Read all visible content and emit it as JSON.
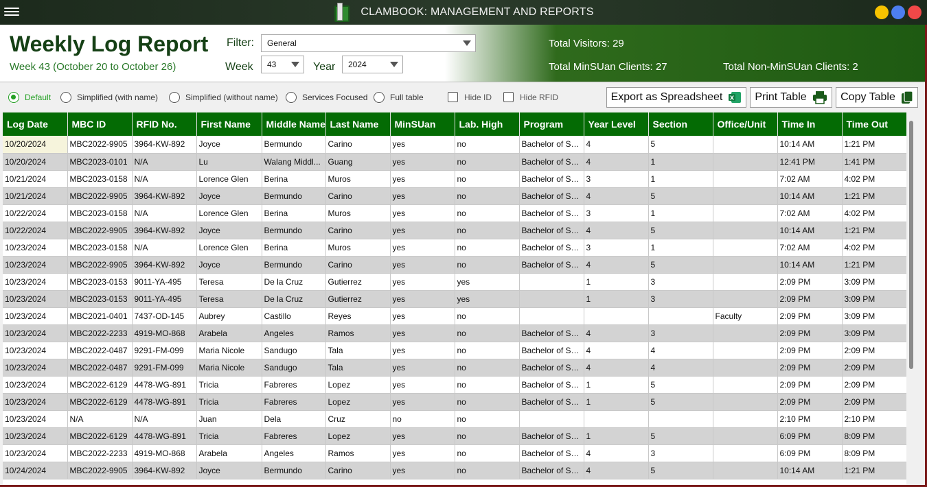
{
  "app": {
    "title": "CLAMBOOK: MANAGEMENT AND REPORTS"
  },
  "colors": {
    "yellow": "#f7c300",
    "blue": "#4d7ef0",
    "red": "#f04848",
    "accent": "#046b04"
  },
  "header": {
    "title": "Weekly Log Report",
    "subtitle": "Week 43 (October 20 to October 26)",
    "filter_label": "Filter:",
    "filter_value": "General",
    "week_label": "Week",
    "week_value": "43",
    "year_label": "Year",
    "year_value": "2024",
    "total_visitors": "Total Visitors: 29",
    "total_minsuan": "Total MinSUan Clients: 27",
    "total_non_minsuan": "Total Non-MinSUan Clients: 2"
  },
  "options": {
    "views": [
      "Default",
      "Simplified (with name)",
      "Simplified (without name)",
      "Services Focused",
      "Full table"
    ],
    "selected_view": "Default",
    "hide_id": "Hide ID",
    "hide_rfid": "Hide RFID",
    "export_label": "Export as Spreadsheet",
    "print_label": "Print Table",
    "copy_label": "Copy Table"
  },
  "table": {
    "columns": [
      "Log Date",
      "MBC ID",
      "RFID No.",
      "First Name",
      "Middle Name",
      "Last Name",
      "MinSUan",
      "Lab. High",
      "Program",
      "Year Level",
      "Section",
      "Office/Unit",
      "Time In",
      "Time Out"
    ],
    "rows": [
      [
        "10/20/2024",
        "MBC2022-9905",
        "3964-KW-892",
        "Joyce",
        "Bermundo",
        "Carino",
        "yes",
        "no",
        "Bachelor of Sc...",
        "4",
        "5",
        "",
        "10:14 AM",
        "1:21 PM"
      ],
      [
        "10/20/2024",
        "MBC2023-0101",
        "N/A",
        "Lu",
        "Walang Middl...",
        "Guang",
        "yes",
        "no",
        "Bachelor of Sc...",
        "4",
        "1",
        "",
        "12:41 PM",
        "1:41 PM"
      ],
      [
        "10/21/2024",
        "MBC2023-0158",
        "N/A",
        "Lorence Glen",
        "Berina",
        "Muros",
        "yes",
        "no",
        "Bachelor of Sc...",
        "3",
        "1",
        "",
        "7:02 AM",
        "4:02 PM"
      ],
      [
        "10/21/2024",
        "MBC2022-9905",
        "3964-KW-892",
        "Joyce",
        "Bermundo",
        "Carino",
        "yes",
        "no",
        "Bachelor of Sc...",
        "4",
        "5",
        "",
        "10:14 AM",
        "1:21 PM"
      ],
      [
        "10/22/2024",
        "MBC2023-0158",
        "N/A",
        "Lorence Glen",
        "Berina",
        "Muros",
        "yes",
        "no",
        "Bachelor of Sc...",
        "3",
        "1",
        "",
        "7:02 AM",
        "4:02 PM"
      ],
      [
        "10/22/2024",
        "MBC2022-9905",
        "3964-KW-892",
        "Joyce",
        "Bermundo",
        "Carino",
        "yes",
        "no",
        "Bachelor of Sc...",
        "4",
        "5",
        "",
        "10:14 AM",
        "1:21 PM"
      ],
      [
        "10/23/2024",
        "MBC2023-0158",
        "N/A",
        "Lorence Glen",
        "Berina",
        "Muros",
        "yes",
        "no",
        "Bachelor of Sc...",
        "3",
        "1",
        "",
        "7:02 AM",
        "4:02 PM"
      ],
      [
        "10/23/2024",
        "MBC2022-9905",
        "3964-KW-892",
        "Joyce",
        "Bermundo",
        "Carino",
        "yes",
        "no",
        "Bachelor of Sc...",
        "4",
        "5",
        "",
        "10:14 AM",
        "1:21 PM"
      ],
      [
        "10/23/2024",
        "MBC2023-0153",
        "9011-YA-495",
        "Teresa",
        "De la Cruz",
        "Gutierrez",
        "yes",
        "yes",
        "",
        "1",
        "3",
        "",
        "2:09 PM",
        "3:09 PM"
      ],
      [
        "10/23/2024",
        "MBC2023-0153",
        "9011-YA-495",
        "Teresa",
        "De la Cruz",
        "Gutierrez",
        "yes",
        "yes",
        "",
        "1",
        "3",
        "",
        "2:09 PM",
        "3:09 PM"
      ],
      [
        "10/23/2024",
        "MBC2021-0401",
        "7437-OD-145",
        "Aubrey",
        "Castillo",
        "Reyes",
        "yes",
        "no",
        "",
        "",
        "",
        "Faculty",
        "2:09 PM",
        "3:09 PM"
      ],
      [
        "10/23/2024",
        "MBC2022-2233",
        "4919-MO-868",
        "Arabela",
        "Angeles",
        "Ramos",
        "yes",
        "no",
        "Bachelor of Sc...",
        "4",
        "3",
        "",
        "2:09 PM",
        "3:09 PM"
      ],
      [
        "10/23/2024",
        "MBC2022-0487",
        "9291-FM-099",
        "Maria Nicole",
        "Sandugo",
        "Tala",
        "yes",
        "no",
        "Bachelor of Sc...",
        "4",
        "4",
        "",
        "2:09 PM",
        "2:09 PM"
      ],
      [
        "10/23/2024",
        "MBC2022-0487",
        "9291-FM-099",
        "Maria Nicole",
        "Sandugo",
        "Tala",
        "yes",
        "no",
        "Bachelor of Sc...",
        "4",
        "4",
        "",
        "2:09 PM",
        "2:09 PM"
      ],
      [
        "10/23/2024",
        "MBC2022-6129",
        "4478-WG-891",
        "Tricia",
        "Fabreres",
        "Lopez",
        "yes",
        "no",
        "Bachelor of Se...",
        "1",
        "5",
        "",
        "2:09 PM",
        "2:09 PM"
      ],
      [
        "10/23/2024",
        "MBC2022-6129",
        "4478-WG-891",
        "Tricia",
        "Fabreres",
        "Lopez",
        "yes",
        "no",
        "Bachelor of Se...",
        "1",
        "5",
        "",
        "2:09 PM",
        "2:09 PM"
      ],
      [
        "10/23/2024",
        "N/A",
        "N/A",
        "Juan",
        "Dela",
        "Cruz",
        "no",
        "no",
        "",
        "",
        "",
        "",
        "2:10 PM",
        "2:10 PM"
      ],
      [
        "10/23/2024",
        "MBC2022-6129",
        "4478-WG-891",
        "Tricia",
        "Fabreres",
        "Lopez",
        "yes",
        "no",
        "Bachelor of Se...",
        "1",
        "5",
        "",
        "6:09 PM",
        "8:09 PM"
      ],
      [
        "10/23/2024",
        "MBC2022-2233",
        "4919-MO-868",
        "Arabela",
        "Angeles",
        "Ramos",
        "yes",
        "no",
        "Bachelor of Sc...",
        "4",
        "3",
        "",
        "6:09 PM",
        "8:09 PM"
      ],
      [
        "10/24/2024",
        "MBC2022-9905",
        "3964-KW-892",
        "Joyce",
        "Bermundo",
        "Carino",
        "yes",
        "no",
        "Bachelor of Sc...",
        "4",
        "5",
        "",
        "10:14 AM",
        "1:21 PM"
      ]
    ]
  }
}
